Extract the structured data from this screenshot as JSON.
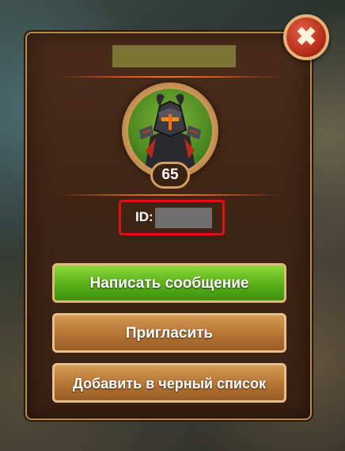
{
  "player": {
    "level": "65",
    "id_label": "ID:"
  },
  "actions": {
    "message_label": "Написать сообщение",
    "invite_label": "Пригласить",
    "blacklist_label": "Добавить в черный список"
  },
  "close": {
    "glyph": "✖"
  },
  "colors": {
    "frame": "#b88a56",
    "panel": "#3e2414",
    "primary_button": "#5cb31c",
    "secondary_button": "#b57434",
    "highlight_box": "#e0101a",
    "close_button": "#b8301c"
  },
  "icons": [
    "armored-hero-portrait",
    "close-icon"
  ]
}
